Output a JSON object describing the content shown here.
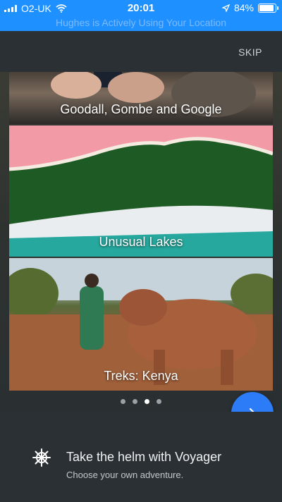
{
  "status_bar": {
    "carrier": "O2-UK",
    "time": "20:01",
    "battery": "84%",
    "battery_level": 0.84,
    "location_banner": "Hughes is Actively Using Your Location",
    "color": "#1e90ff"
  },
  "header": {
    "skip_label": "SKIP"
  },
  "cards": [
    {
      "title": "Goodall, Gombe and Google"
    },
    {
      "title": "Unusual Lakes"
    },
    {
      "title": "Treks: Kenya"
    }
  ],
  "pagination": {
    "count": 4,
    "active_index": 2
  },
  "next_button": {
    "icon": "chevron-right-icon",
    "color": "#2b7cf6"
  },
  "footer": {
    "icon": "ship-wheel-icon",
    "title": "Take the helm with Voyager",
    "subtitle": "Choose your own adventure."
  }
}
